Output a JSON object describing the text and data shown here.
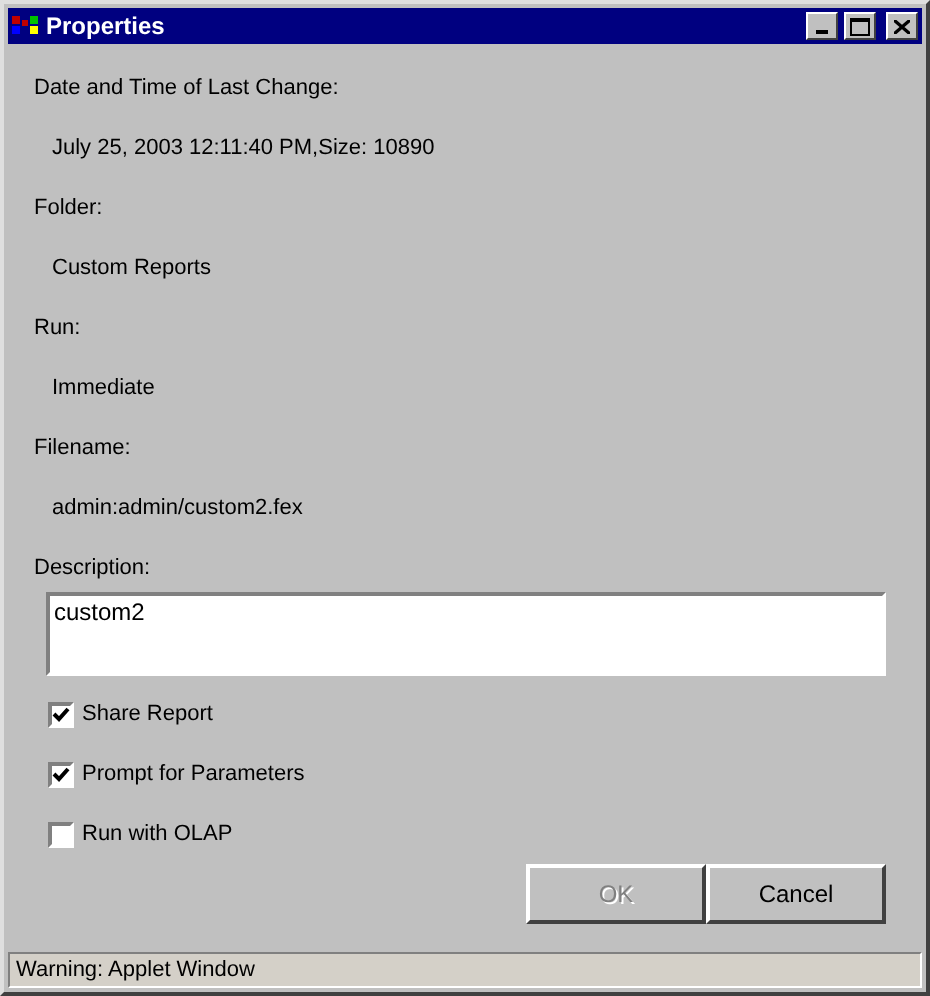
{
  "window": {
    "title": "Properties"
  },
  "fields": [
    {
      "label": "Date and Time of Last Change:",
      "value": "July 25, 2003 12:11:40 PM,Size: 10890"
    },
    {
      "label": "Folder:",
      "value": "Custom Reports"
    },
    {
      "label": "Run:",
      "value": "Immediate"
    },
    {
      "label": "Filename:",
      "value": "admin:admin/custom2.fex"
    }
  ],
  "description": {
    "label": "Description:",
    "value": "custom2"
  },
  "options": [
    {
      "label": "Share Report",
      "checked": true
    },
    {
      "label": "Prompt for Parameters",
      "checked": true
    },
    {
      "label": "Run with OLAP",
      "checked": false
    }
  ],
  "buttons": [
    {
      "label": "OK",
      "disabled": true
    },
    {
      "label": "Cancel",
      "disabled": false
    }
  ],
  "status_bar": "Warning: Applet Window"
}
